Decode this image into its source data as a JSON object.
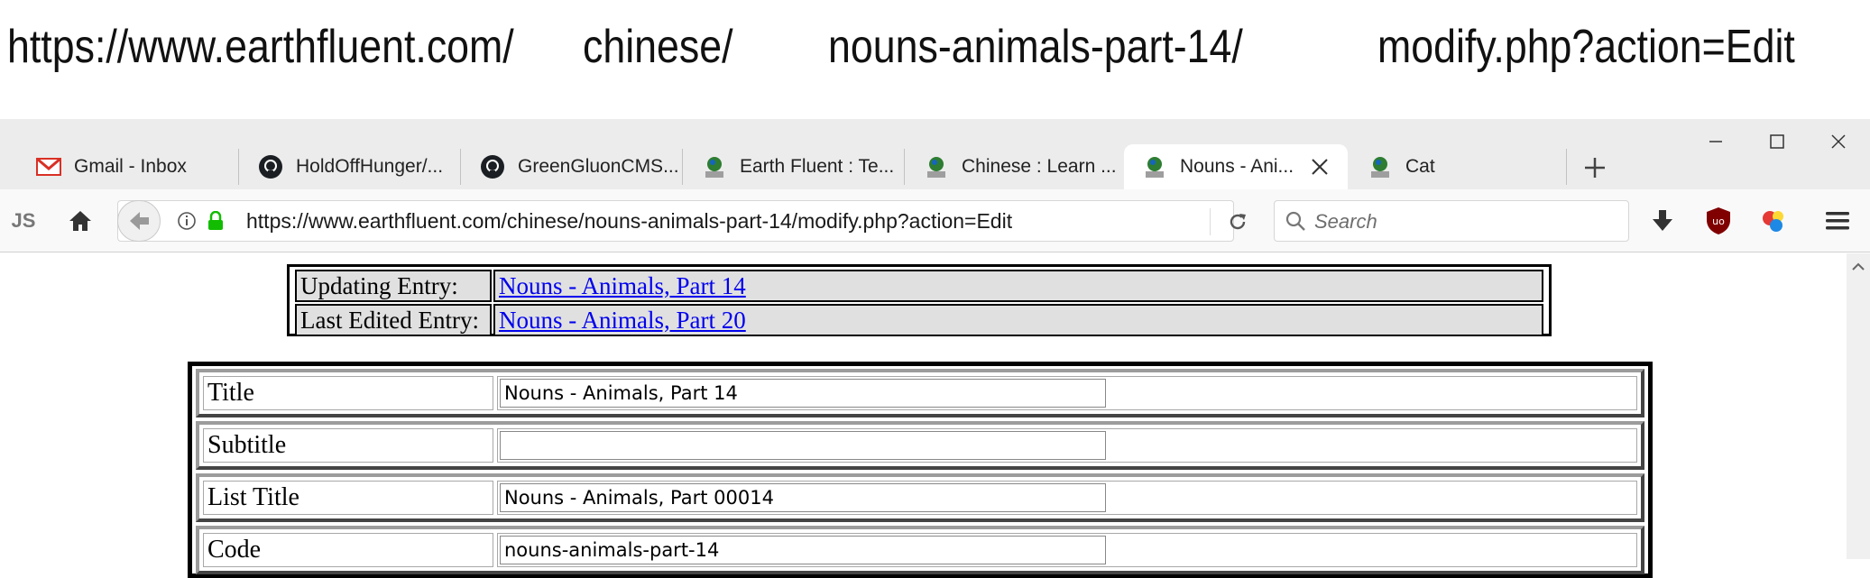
{
  "url_banner": {
    "seg1": "https://www.earthfluent.com/",
    "seg2": "chinese/",
    "seg3": "nouns-animals-part-14/",
    "seg4": "modify.php?action=Edit"
  },
  "tabs": [
    {
      "label": "Gmail - Inbox",
      "icon": "gmail-icon"
    },
    {
      "label": "HoldOffHunger/...",
      "icon": "github-icon"
    },
    {
      "label": "GreenGluonCMS...",
      "icon": "github-icon"
    },
    {
      "label": "Earth Fluent : Te...",
      "icon": "earth-icon"
    },
    {
      "label": "Chinese : Learn ...",
      "icon": "earth-icon"
    },
    {
      "label": "Nouns - Ani...",
      "icon": "earth-icon",
      "active": true
    },
    {
      "label": "Cat",
      "icon": "earth-icon"
    }
  ],
  "navbar": {
    "js_label": "JS",
    "url": "https://www.earthfluent.com/chinese/nouns-animals-part-14/modify.php?action=Edit",
    "search_placeholder": "Search"
  },
  "info": {
    "updating_label": "Updating Entry:",
    "updating_link": "Nouns - Animals, Part 14",
    "last_label": "Last Edited Entry:",
    "last_link": "Nouns - Animals, Part 20"
  },
  "form": {
    "rows": [
      {
        "label": "Title",
        "value": "Nouns - Animals, Part 14"
      },
      {
        "label": "Subtitle",
        "value": ""
      },
      {
        "label": "List Title",
        "value": "Nouns - Animals, Part 00014"
      },
      {
        "label": "Code",
        "value": "nouns-animals-part-14"
      }
    ]
  },
  "colors": {
    "link": "#0000ee",
    "gmail_red": "#d93025",
    "lock_green": "#12bc00",
    "ublock_red": "#800000"
  }
}
